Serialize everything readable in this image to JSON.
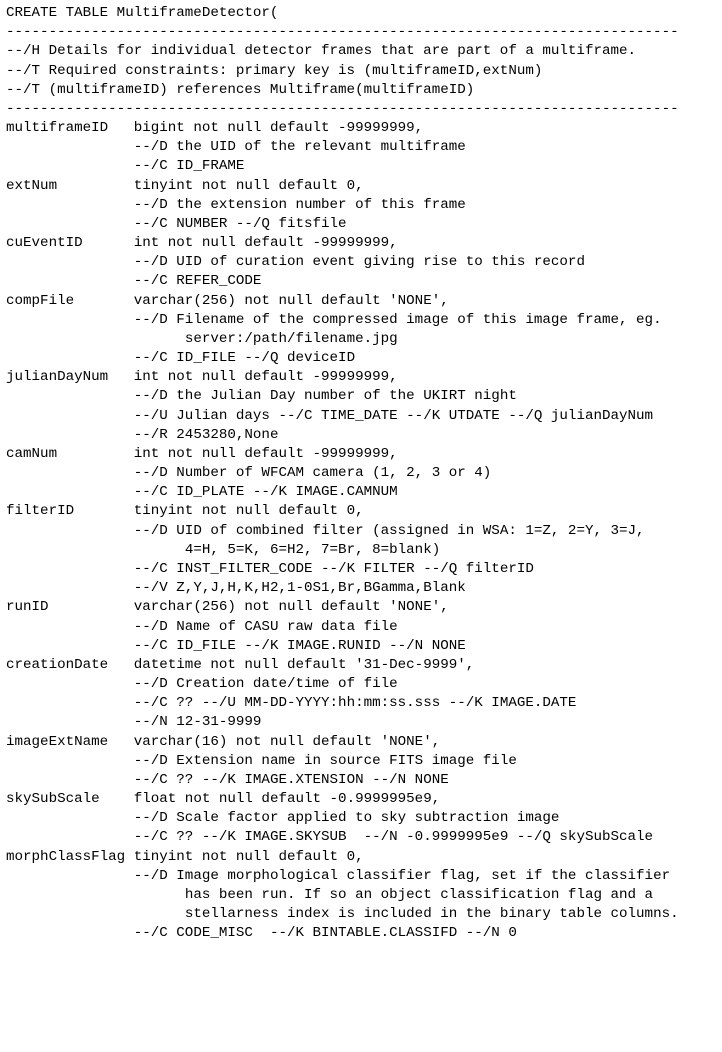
{
  "table_decl": "CREATE TABLE MultiframeDetector(",
  "hr": "-------------------------------------------------------------------------------",
  "header": {
    "h": "--/H Details for individual detector frames that are part of a multiframe.",
    "t1": "--/T Required constraints: primary key is (multiframeID,extNum)",
    "t2": "--/T (multiframeID) references Multiframe(multiframeID)"
  },
  "columns": [
    {
      "name": "multiframeID",
      "type": "bigint not null default -99999999,",
      "lines": [
        "--/D the UID of the relevant multiframe",
        "--/C ID_FRAME"
      ]
    },
    {
      "name": "extNum",
      "type": "tinyint not null default 0,",
      "lines": [
        "--/D the extension number of this frame",
        "--/C NUMBER --/Q fitsfile"
      ]
    },
    {
      "name": "cuEventID",
      "type": "int not null default -99999999,",
      "lines": [
        "--/D UID of curation event giving rise to this record",
        "--/C REFER_CODE"
      ]
    },
    {
      "name": "compFile",
      "type": "varchar(256) not null default 'NONE',",
      "lines": [
        "--/D Filename of the compressed image of this image frame, eg.",
        "server:/path/filename.jpg",
        "--/C ID_FILE --/Q deviceID"
      ],
      "linesIndent": [
        0,
        1,
        0
      ]
    },
    {
      "name": "julianDayNum",
      "type": "int not null default -99999999,",
      "lines": [
        "--/D the Julian Day number of the UKIRT night",
        "--/U Julian days --/C TIME_DATE --/K UTDATE --/Q julianDayNum",
        "--/R 2453280,None"
      ]
    },
    {
      "name": "camNum",
      "type": "int not null default -99999999,",
      "lines": [
        "--/D Number of WFCAM camera (1, 2, 3 or 4)",
        "--/C ID_PLATE --/K IMAGE.CAMNUM"
      ]
    },
    {
      "name": "filterID",
      "type": "tinyint not null default 0,",
      "lines": [
        "--/D UID of combined filter (assigned in WSA: 1=Z, 2=Y, 3=J,",
        "4=H, 5=K, 6=H2, 7=Br, 8=blank)",
        "--/C INST_FILTER_CODE --/K FILTER --/Q filterID",
        "--/V Z,Y,J,H,K,H2,1-0S1,Br,BGamma,Blank"
      ],
      "linesIndent": [
        0,
        1,
        0,
        0
      ]
    },
    {
      "name": "runID",
      "type": "varchar(256) not null default 'NONE',",
      "lines": [
        "--/D Name of CASU raw data file",
        "--/C ID_FILE --/K IMAGE.RUNID --/N NONE"
      ]
    },
    {
      "name": "creationDate",
      "type": "datetime not null default '31-Dec-9999',",
      "lines": [
        "--/D Creation date/time of file",
        "--/C ?? --/U MM-DD-YYYY:hh:mm:ss.sss --/K IMAGE.DATE",
        "--/N 12-31-9999"
      ]
    },
    {
      "name": "imageExtName",
      "type": "varchar(16) not null default 'NONE',",
      "lines": [
        "--/D Extension name in source FITS image file",
        "--/C ?? --/K IMAGE.XTENSION --/N NONE"
      ]
    },
    {
      "name": "skySubScale",
      "type": "float not null default -0.9999995e9,",
      "lines": [
        "--/D Scale factor applied to sky subtraction image",
        "--/C ?? --/K IMAGE.SKYSUB  --/N -0.9999995e9 --/Q skySubScale"
      ]
    },
    {
      "name": "morphClassFlag",
      "type": "tinyint not null default 0,",
      "lines": [
        "--/D Image morphological classifier flag, set if the classifier",
        "has been run. If so an object classification flag and a",
        "stellarness index is included in the binary table columns.",
        "--/C CODE_MISC  --/K BINTABLE.CLASSIFD --/N 0"
      ],
      "linesIndent": [
        0,
        1,
        1,
        0
      ]
    }
  ]
}
